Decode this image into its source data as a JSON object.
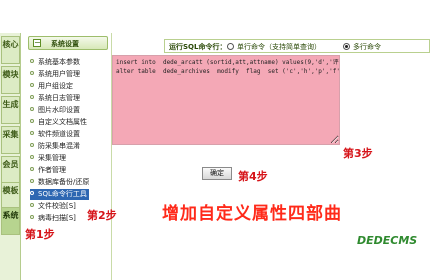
{
  "side_tabs": [
    "核心",
    "模块",
    "生成",
    "采集",
    "会员",
    "模板",
    "系统"
  ],
  "menu": {
    "header": "系统设置",
    "items": [
      "系统基本参数",
      "系统用户管理",
      "用户组设定",
      "系统日志管理",
      "图片水印设置",
      "自定义文档属性",
      "软件频道设置",
      "防采集串混淆",
      "采集管理",
      "作者管理",
      "数据库备份/还原",
      "SQL命令行工具",
      "文件校验[S]",
      "病毒扫描[S]"
    ],
    "selected_index": 11
  },
  "toolbar": {
    "label": "运行SQL命令行：",
    "option1": "单行命令（支持简单查询）",
    "option2": "多行命令",
    "selected": "多行命令"
  },
  "sql_text": "insert into  dede_arcatt (sortid,att,attname) values(9,'d','评\nalter table  dede_archives  modify  flag  set ('c','h','p','f',",
  "ok_button": "确定",
  "annotations": {
    "step1": "第1步",
    "step2": "第2步",
    "step3": "第3步",
    "step4": "第4步",
    "title": "增加自定义属性四部曲"
  },
  "logo": "DEDECMS",
  "colors": {
    "accent_red": "#d6151a",
    "title_red": "#ff2a1a",
    "sql_bg": "#f4a8b6",
    "menu_select": "#2e67b2",
    "logo_green": "#2f8a2f"
  }
}
